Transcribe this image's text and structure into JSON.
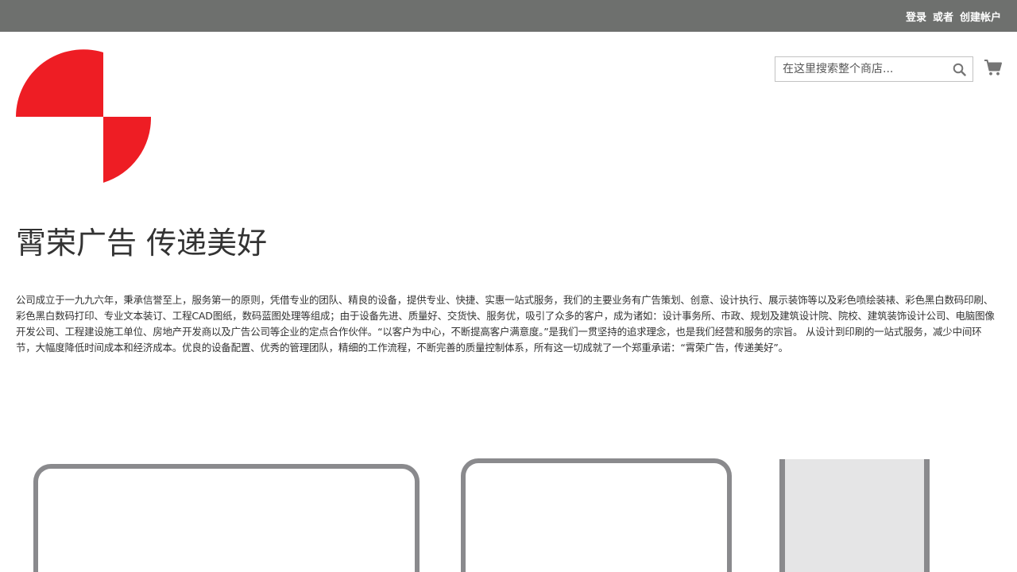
{
  "header": {
    "links": [
      {
        "label": "登录"
      },
      {
        "label": "或者"
      },
      {
        "label": "创建帐户"
      }
    ]
  },
  "search": {
    "placeholder": "在这里搜索整个商店...",
    "icon": "search-icon"
  },
  "cart": {
    "icon": "shopping-cart-icon"
  },
  "logo": {
    "icon": "brand-logo",
    "color": "#ee1d24"
  },
  "main": {
    "title": "霄荣广告 传递美好",
    "intro": "公司成立于一九九六年，秉承信誉至上，服务第一的原则，凭借专业的团队、精良的设备，提供专业、快捷、实惠一站式服务，我们的主要业务有广告策划、创意、设计执行、展示装饰等以及彩色喷绘装裱、彩色黑白数码印刷、彩色黑白数码打印、专业文本装订、工程CAD图纸，数码蓝图处理等组成；由于设备先进、质量好、交货快、服务优，吸引了众多的客户，成为诸如：设计事务所、市政、规划及建筑设计院、院校、建筑装饰设计公司、电脑图像开发公司、工程建设施工单位、房地产开发商以及广告公司等企业的定点合作伙伴。“以客户为中心，不断提高客户满意度。”是我们一贯坚持的追求理念，也是我们经营和服务的宗旨。 从设计到印刷的一站式服务，减少中间环节，大幅度降低时间成本和经济成本。优良的设备配置、优秀的管理团队，精细的工作流程，不断完善的质量控制体系，所有这一切成就了一个郑重承诺：“霄荣广告，传递美好”。"
  },
  "colors": {
    "topbar": "#6e706e",
    "frame": "#8a8a8d",
    "frame_fill": "#e5e5e6",
    "text": "#333333"
  }
}
